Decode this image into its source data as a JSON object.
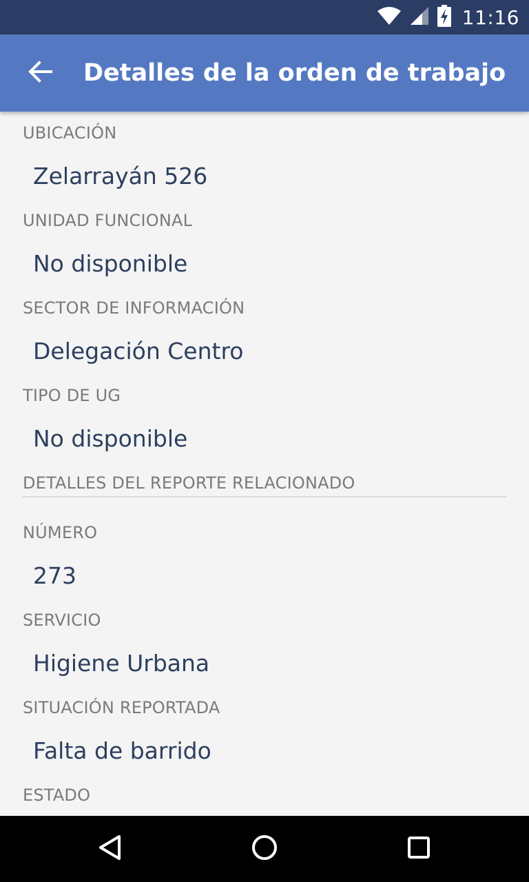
{
  "status_bar": {
    "time": "11:16",
    "icons": [
      "wifi-icon",
      "cell-signal-icon",
      "battery-charging-icon"
    ]
  },
  "app_bar": {
    "back_icon": "arrow-back-icon",
    "title": "Detalles de la orden de trabajo"
  },
  "fields": {
    "ubicacion": {
      "label": "UBICACIÓN",
      "value": "Zelarrayán 526"
    },
    "unidad_funcional": {
      "label": "UNIDAD FUNCIONAL",
      "value": "No disponible"
    },
    "sector_informacion": {
      "label": "SECTOR DE INFORMACIÓN",
      "value": "Delegación Centro"
    },
    "tipo_ug": {
      "label": "TIPO DE UG",
      "value": "No disponible"
    }
  },
  "report_section": {
    "header": "DETALLES DEL REPORTE RELACIONADO",
    "numero": {
      "label": "NÚMERO",
      "value": "273"
    },
    "servicio": {
      "label": "SERVICIO",
      "value": "Higiene Urbana"
    },
    "situacion": {
      "label": "SITUACIÓN REPORTADA",
      "value": "Falta de barrido"
    },
    "estado": {
      "label": "ESTADO"
    }
  },
  "nav_bar": {
    "icons": [
      "back-triangle-icon",
      "home-circle-icon",
      "recents-square-icon"
    ]
  },
  "colors": {
    "status_bar": "#2b3d65",
    "app_bar": "#5479c2",
    "background": "#f4f4f4",
    "label_text": "#7a7a7a",
    "value_text": "#2d3f5e"
  }
}
